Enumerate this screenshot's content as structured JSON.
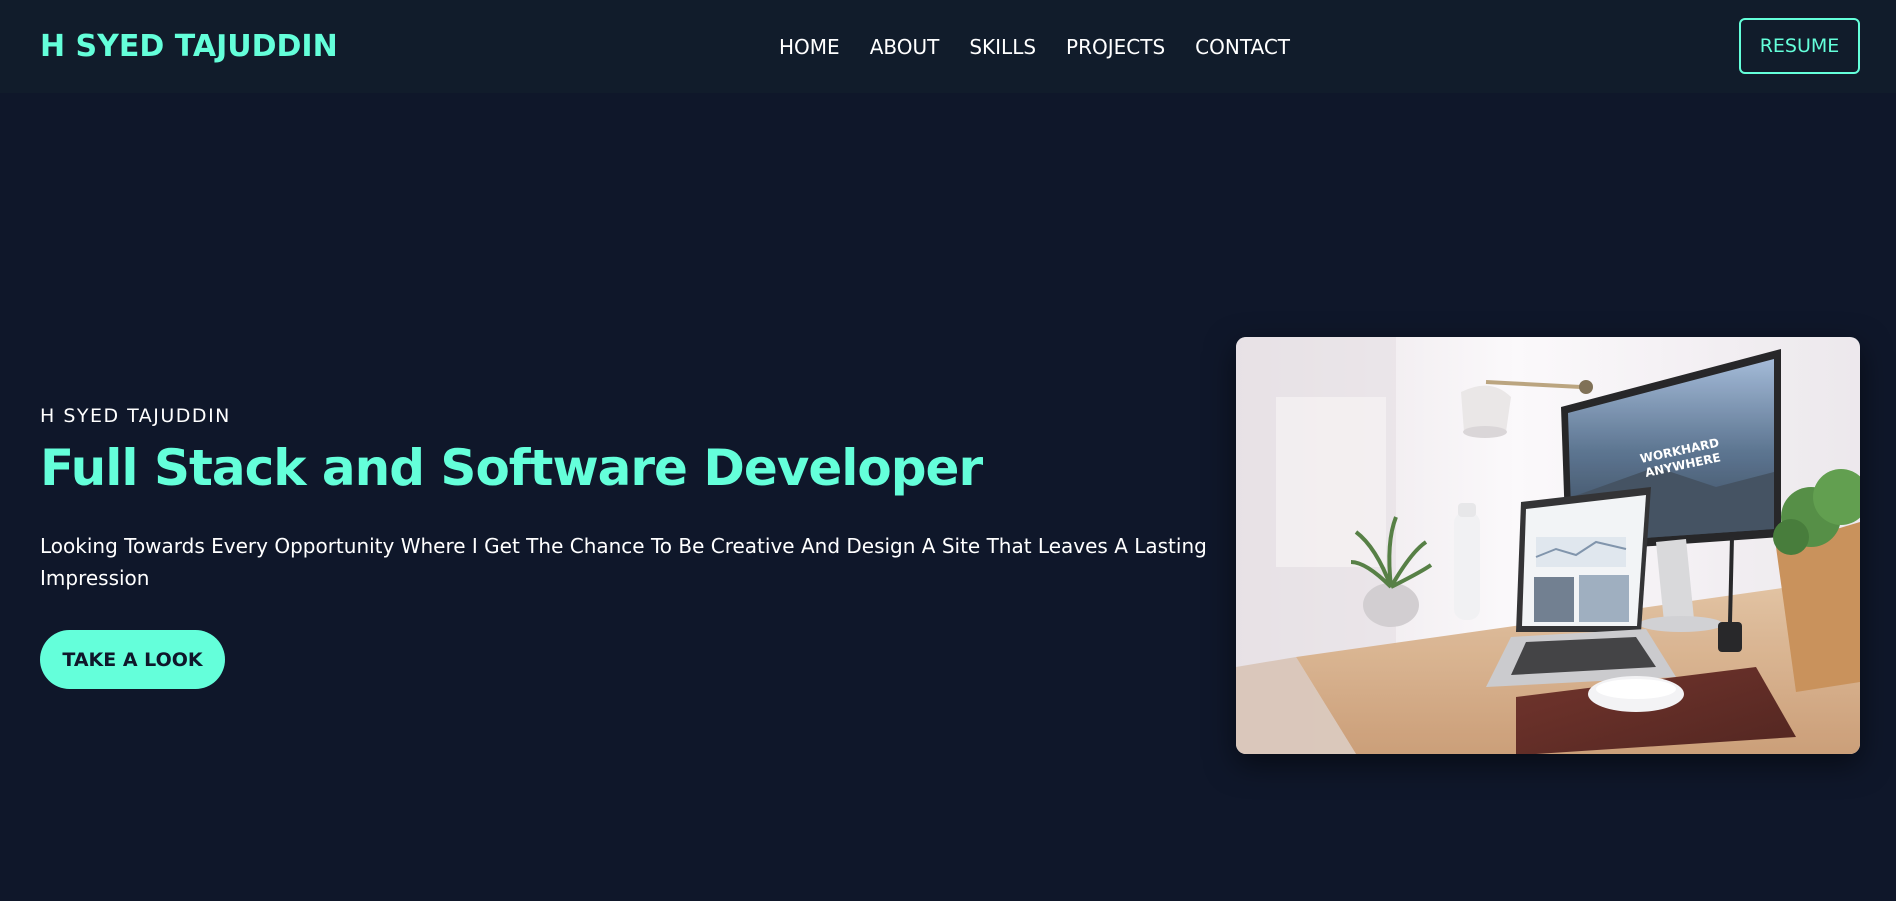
{
  "header": {
    "logo": "H SYED TAJUDDIN",
    "nav": [
      {
        "label": "HOME"
      },
      {
        "label": "ABOUT"
      },
      {
        "label": "SKILLS"
      },
      {
        "label": "PROJECTS"
      },
      {
        "label": "CONTACT"
      }
    ],
    "resume_label": "RESUME"
  },
  "hero": {
    "name": "H SYED TAJUDDIN",
    "title": "Full Stack and Software Developer",
    "description": "Looking Towards Every Opportunity Where I Get The Chance To Be Creative And Design A Site That Leaves A Lasting Impression",
    "cta_label": "TAKE A LOOK",
    "image_alt": "desk workspace photo",
    "monitor_text_1": "WORKHARD",
    "monitor_text_2": "ANYWHERE"
  },
  "colors": {
    "accent": "#64ffda",
    "background": "#0f172a",
    "navbar": "#111c2b"
  }
}
